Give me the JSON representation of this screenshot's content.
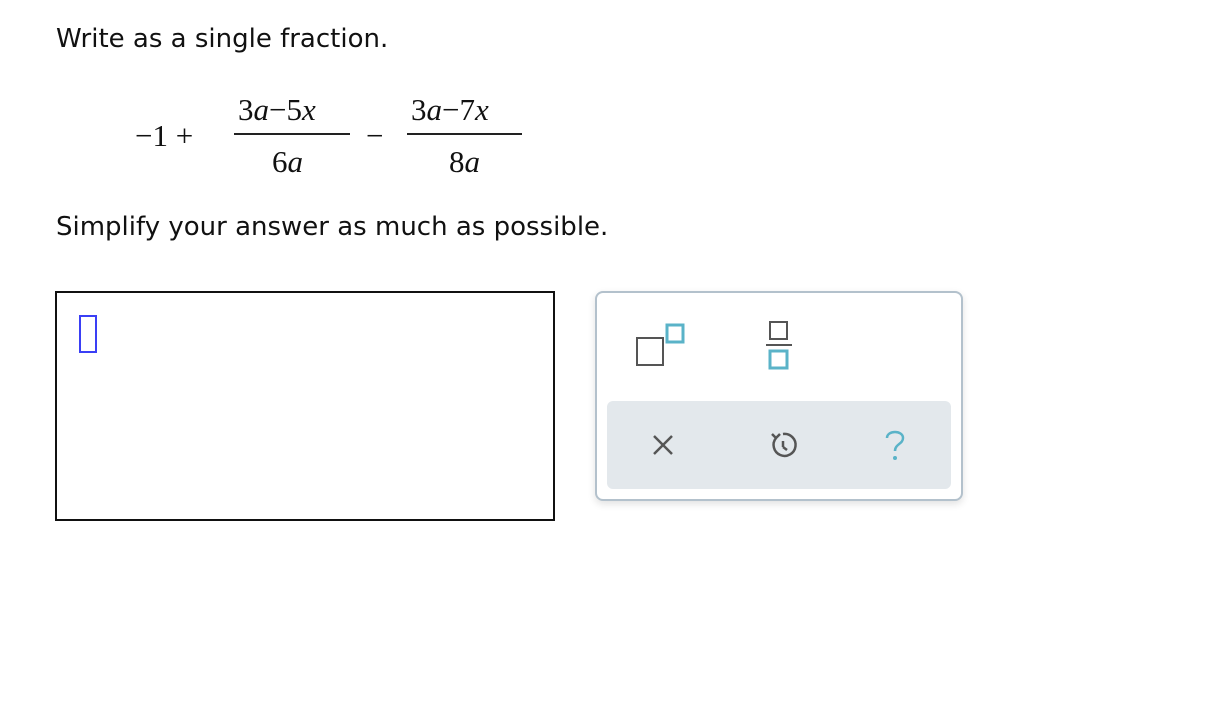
{
  "question": {
    "instruction": "Write as a single fraction.",
    "expression": {
      "leading": "−1 +",
      "fraction1": {
        "numerator": {
          "c1": "3",
          "v1": "a",
          "op": "−",
          "c2": "5",
          "v2": "x"
        },
        "denominator": {
          "c": "6",
          "v": "a"
        }
      },
      "operator": "−",
      "fraction2": {
        "numerator": {
          "c1": "3",
          "v1": "a",
          "op": "−",
          "c2": "7",
          "v2": "x"
        },
        "denominator": {
          "c": "8",
          "v": "a"
        }
      }
    },
    "directions": "Simplify your answer as much as possible."
  },
  "answer": {
    "value": ""
  },
  "palette": {
    "tools": [
      {
        "name": "superscript",
        "icon": "exponent-icon"
      },
      {
        "name": "fraction",
        "icon": "fraction-icon"
      }
    ],
    "actions": [
      {
        "name": "clear",
        "icon": "close-icon"
      },
      {
        "name": "undo",
        "icon": "undo-icon"
      },
      {
        "name": "help",
        "icon": "help-icon"
      }
    ]
  },
  "colors": {
    "accent": "#5ab3c8",
    "cursor": "#3a3ff5",
    "palette_border": "#b3c1cc",
    "action_bar": "#e3e8ec",
    "icon": "#555555"
  }
}
